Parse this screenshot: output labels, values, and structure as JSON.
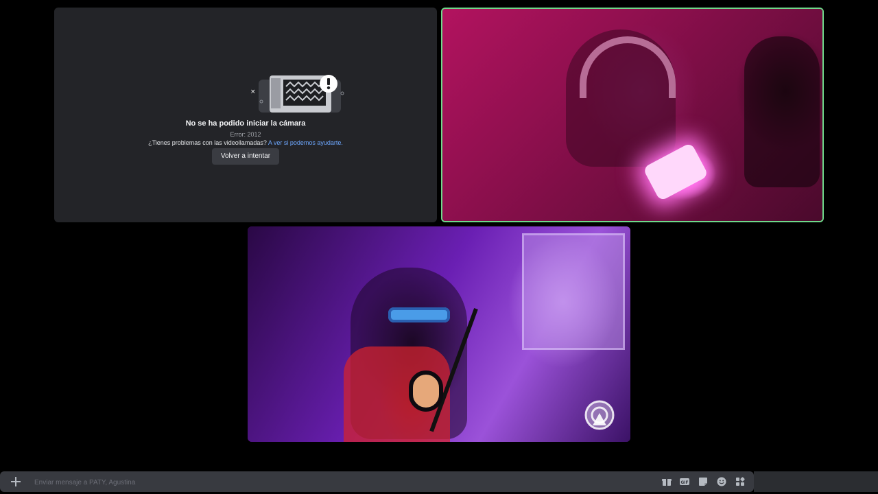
{
  "error_tile": {
    "title": "No se ha podido iniciar la cámara",
    "code": "Error: 2012",
    "help_text": "¿Tienes problemas con las videollamadas?",
    "help_link": "A ver si podemos ayudarte.",
    "retry_label": "Volver a intentar"
  },
  "composer": {
    "placeholder": "Enviar mensaje a PATY, Agustina",
    "tools": [
      "gift-icon",
      "gif-icon",
      "sticker-icon",
      "emoji-icon",
      "apps-icon"
    ]
  },
  "colors": {
    "speaking_border": "#6fd98a",
    "link": "#6ea8ff",
    "tile_bg": "#232428"
  }
}
